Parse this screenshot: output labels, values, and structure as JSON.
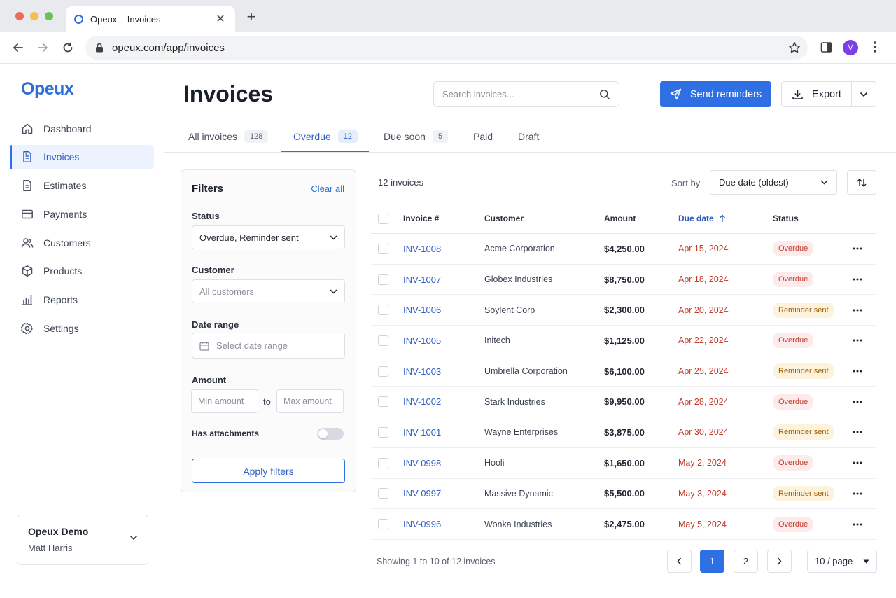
{
  "browser": {
    "tab_title": "Opeux – Invoices",
    "url": "opeux.com/app/invoices",
    "avatar_initial": "M"
  },
  "sidebar": {
    "logo": "Opeux",
    "items": [
      {
        "label": "Dashboard",
        "icon": "home-icon"
      },
      {
        "label": "Invoices",
        "icon": "invoice-icon",
        "active": true
      },
      {
        "label": "Estimates",
        "icon": "estimate-icon"
      },
      {
        "label": "Payments",
        "icon": "card-icon"
      },
      {
        "label": "Customers",
        "icon": "users-icon"
      },
      {
        "label": "Products",
        "icon": "box-icon"
      },
      {
        "label": "Reports",
        "icon": "bar-chart-icon"
      },
      {
        "label": "Settings",
        "icon": "gear-icon"
      }
    ],
    "account": {
      "org": "Opeux Demo",
      "user": "Matt Harris"
    }
  },
  "header": {
    "title": "Invoices",
    "search_placeholder": "Search invoices...",
    "primary_button": "Send reminders",
    "export_button": "Export"
  },
  "tabs": [
    {
      "label": "All invoices",
      "count": "128"
    },
    {
      "label": "Overdue",
      "count": "12",
      "active": true
    },
    {
      "label": "Due soon",
      "count": "5"
    },
    {
      "label": "Paid",
      "count": ""
    },
    {
      "label": "Draft",
      "count": ""
    }
  ],
  "filters": {
    "title": "Filters",
    "clear_all": "Clear all",
    "status_label": "Status",
    "status_value": "Overdue, Reminder sent",
    "customer_label": "Customer",
    "customer_placeholder": "All customers",
    "date_label": "Date range",
    "date_placeholder": "Select date range",
    "amount_label": "Amount",
    "min_placeholder": "Min amount",
    "to_text": "to",
    "max_placeholder": "Max amount",
    "attachments_label": "Has attachments",
    "attachments_on": false,
    "apply_button": "Apply filters"
  },
  "list": {
    "count_text": "12 invoices",
    "sort_label": "Sort by",
    "sort_value": "Due date (oldest)",
    "columns": [
      "Invoice #",
      "Customer",
      "Amount",
      "Due date",
      "Status"
    ],
    "rows": [
      {
        "invoice": "INV-1008",
        "customer": "Acme Corporation",
        "amount": "$4,250.00",
        "due": "Apr 15, 2024",
        "status": "Overdue"
      },
      {
        "invoice": "INV-1007",
        "customer": "Globex Industries",
        "amount": "$8,750.00",
        "due": "Apr 18, 2024",
        "status": "Overdue"
      },
      {
        "invoice": "INV-1006",
        "customer": "Soylent Corp",
        "amount": "$2,300.00",
        "due": "Apr 20, 2024",
        "status": "Reminder sent"
      },
      {
        "invoice": "INV-1005",
        "customer": "Initech",
        "amount": "$1,125.00",
        "due": "Apr 22, 2024",
        "status": "Overdue"
      },
      {
        "invoice": "INV-1003",
        "customer": "Umbrella Corporation",
        "amount": "$6,100.00",
        "due": "Apr 25, 2024",
        "status": "Reminder sent"
      },
      {
        "invoice": "INV-1002",
        "customer": "Stark Industries",
        "amount": "$9,950.00",
        "due": "Apr 28, 2024",
        "status": "Overdue"
      },
      {
        "invoice": "INV-1001",
        "customer": "Wayne Enterprises",
        "amount": "$3,875.00",
        "due": "Apr 30, 2024",
        "status": "Reminder sent"
      },
      {
        "invoice": "INV-0998",
        "customer": "Hooli",
        "amount": "$1,650.00",
        "due": "May 2, 2024",
        "status": "Overdue"
      },
      {
        "invoice": "INV-0997",
        "customer": "Massive Dynamic",
        "amount": "$5,500.00",
        "due": "May 3, 2024",
        "status": "Reminder sent"
      },
      {
        "invoice": "INV-0996",
        "customer": "Wonka Industries",
        "amount": "$2,475.00",
        "due": "May 5, 2024",
        "status": "Overdue"
      }
    ]
  },
  "pagination": {
    "showing": "Showing 1 to 10 of 12 invoices",
    "pages": [
      "1",
      "2"
    ],
    "current": "1",
    "per_page": "10 / page"
  }
}
